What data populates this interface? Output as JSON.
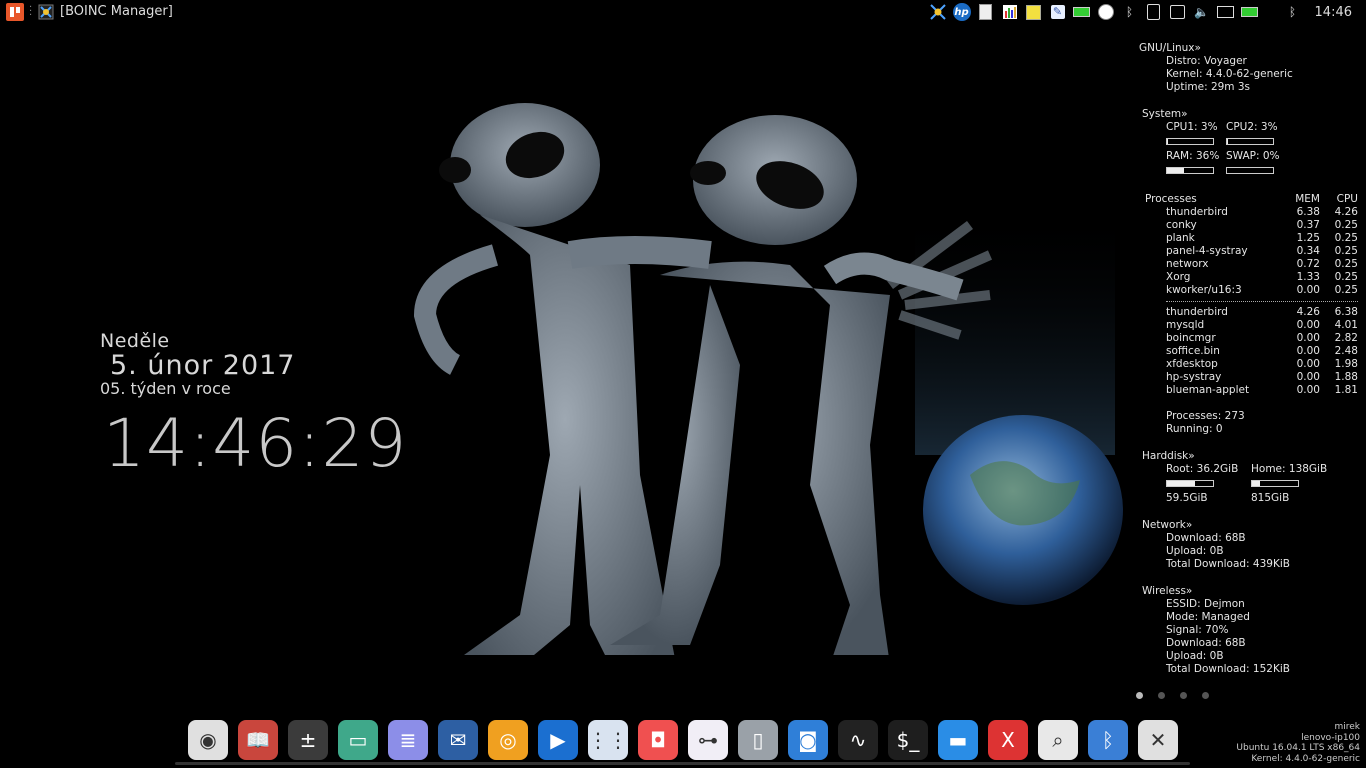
{
  "top_panel": {
    "window_title": "[BOINC Manager]",
    "clock": "14:46",
    "tray_icons": [
      "boinc-icon",
      "hp-icon",
      "document-icon",
      "chart-icon",
      "notes-icon",
      "pen-icon",
      "battery-icon",
      "timer-icon",
      "bluetooth-icon",
      "clipboard-icon",
      "display-icon",
      "volume-icon",
      "mail-icon",
      "battery-icon",
      "bluetooth-icon"
    ]
  },
  "date_widget": {
    "day_name": "Neděle",
    "date": "5.  únor  2017",
    "week": "05.  týden v roce",
    "time": "14:46:29"
  },
  "conky": {
    "gnu": {
      "header": "GNU/Linux»",
      "distro": "Distro: Voyager",
      "kernel": "Kernel: 4.4.0-62-generic",
      "uptime": "Uptime: 29m 3s"
    },
    "system": {
      "header": "System»",
      "cpu1": "CPU1: 3%",
      "cpu2": "CPU2: 3%",
      "ram": "RAM: 36%",
      "swap": "SWAP: 0%",
      "cpu1_value": 3,
      "cpu2_value": 3,
      "ram_value": 36,
      "swap_value": 0
    },
    "processes": {
      "header": "Processes",
      "mem_label": "MEM",
      "cpu_label": "CPU",
      "top_cpu": [
        {
          "name": "thunderbird",
          "mem": "6.38",
          "cpu": "4.26"
        },
        {
          "name": "conky",
          "mem": "0.37",
          "cpu": "0.25"
        },
        {
          "name": "plank",
          "mem": "1.25",
          "cpu": "0.25"
        },
        {
          "name": "panel-4-systray",
          "mem": "0.34",
          "cpu": "0.25"
        },
        {
          "name": "networx",
          "mem": "0.72",
          "cpu": "0.25"
        },
        {
          "name": "Xorg",
          "mem": "1.33",
          "cpu": "0.25"
        },
        {
          "name": "kworker/u16:3",
          "mem": "0.00",
          "cpu": "0.25"
        }
      ],
      "top_mem": [
        {
          "name": "thunderbird",
          "mem": "4.26",
          "cpu": "6.38"
        },
        {
          "name": "mysqld",
          "mem": "0.00",
          "cpu": "4.01"
        },
        {
          "name": "boincmgr",
          "mem": "0.00",
          "cpu": "2.82"
        },
        {
          "name": "soffice.bin",
          "mem": "0.00",
          "cpu": "2.48"
        },
        {
          "name": "xfdesktop",
          "mem": "0.00",
          "cpu": "1.98"
        },
        {
          "name": "hp-systray",
          "mem": "0.00",
          "cpu": "1.88"
        },
        {
          "name": "blueman-applet",
          "mem": "0.00",
          "cpu": "1.81"
        }
      ],
      "total": "Processes: 273",
      "running": "Running: 0"
    },
    "harddisk": {
      "header": "Harddisk»",
      "root": "Root: 36.2GiB",
      "home": "Home: 138GiB",
      "root_size": "59.5GiB",
      "home_size": "815GiB",
      "root_used_fraction": 0.61,
      "home_used_fraction": 0.17
    },
    "network": {
      "header": "Network»",
      "download": "Download: 68B",
      "upload": "Upload: 0B",
      "total": "Total Download: 439KiB"
    },
    "wireless": {
      "header": "Wireless»",
      "essid": "ESSID: Dejmon",
      "mode": "Mode: Managed",
      "signal": "Signal: 70%",
      "download": "Download: 68B",
      "upload": "Upload: 0B",
      "total": "Total Download: 152KiB"
    }
  },
  "dock": {
    "items": [
      {
        "name": "chrome",
        "color": "#e0e0e0"
      },
      {
        "name": "book-reader",
        "color": "#c9463d"
      },
      {
        "name": "calculator",
        "color": "#3b3b3b"
      },
      {
        "name": "files",
        "color": "#3fa88a"
      },
      {
        "name": "text-editor",
        "color": "#8c8ee8"
      },
      {
        "name": "thunderbird",
        "color": "#2d5fa3"
      },
      {
        "name": "xnview",
        "color": "#f0a020"
      },
      {
        "name": "media-player",
        "color": "#1b6fd0"
      },
      {
        "name": "app-grid",
        "color": "#d9e3f0"
      },
      {
        "name": "screen-recorder",
        "color": "#f05050"
      },
      {
        "name": "settings-toggle",
        "color": "#f1eef6"
      },
      {
        "name": "trash",
        "color": "#9aa1a8"
      },
      {
        "name": "screenshot",
        "color": "#2f7fd8"
      },
      {
        "name": "system-monitor",
        "color": "#222"
      },
      {
        "name": "terminal",
        "color": "#1e1e1e"
      },
      {
        "name": "desktop",
        "color": "#2a8de6"
      },
      {
        "name": "xfd",
        "color": "#d33"
      },
      {
        "name": "search",
        "color": "#e8e8e8"
      },
      {
        "name": "bluetooth-app",
        "color": "#3a7fd6"
      },
      {
        "name": "boinc",
        "color": "#e0e0e0"
      }
    ]
  },
  "sysinfo": {
    "user": "mirek",
    "host": "lenovo-ip100",
    "os": "Ubuntu 16.04.1 LTS  x86_64",
    "kernel": "Kernel: 4.4.0-62-generic"
  }
}
